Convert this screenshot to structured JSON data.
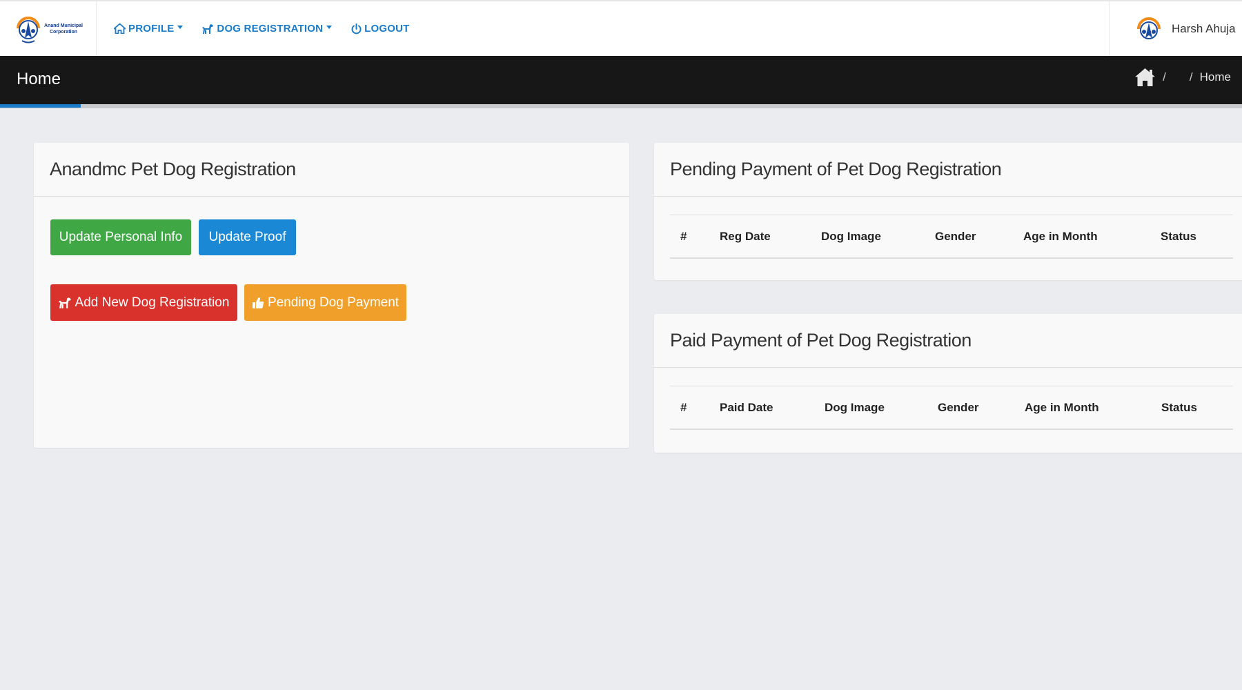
{
  "brand": {
    "logo_text_line1": "Anand Municipal",
    "logo_text_line2": "Corporation"
  },
  "nav": {
    "profile": "PROFILE",
    "dog_registration": "DOG REGISTRATION",
    "logout": "LOGOUT"
  },
  "user": {
    "name": "Harsh Ahuja"
  },
  "titlebar": {
    "title": "Home",
    "sep1": "/",
    "sep2": "/",
    "crumb": "Home"
  },
  "card_registration": {
    "title": "Anandmc Pet Dog Registration",
    "update_personal_info": "Update Personal Info",
    "update_proof": "Update Proof",
    "add_new_dog": "Add New Dog Registration",
    "pending_dog_payment": "Pending Dog Payment"
  },
  "card_pending": {
    "title": "Pending Payment of Pet Dog Registration",
    "columns": [
      "#",
      "Reg Date",
      "Dog Image",
      "Gender",
      "Age in Month",
      "Status"
    ]
  },
  "card_paid": {
    "title": "Paid Payment of Pet Dog Registration",
    "columns": [
      "#",
      "Paid Date",
      "Dog Image",
      "Gender",
      "Age in Month",
      "Status"
    ]
  },
  "colors": {
    "nav_link": "#1a7bc9",
    "titlebar_bg": "#171717",
    "green": "#3fa845",
    "blue": "#1a88d4",
    "red": "#d9312c",
    "orange": "#f0a02a",
    "page_bg": "#ebecef"
  },
  "icons": {
    "profile": "home-icon",
    "dog_registration": "dog-icon",
    "logout": "power-icon",
    "breadcrumb": "home-icon",
    "add_new_dog": "dog-icon",
    "pending_dog_payment": "thumbs-up-icon"
  }
}
